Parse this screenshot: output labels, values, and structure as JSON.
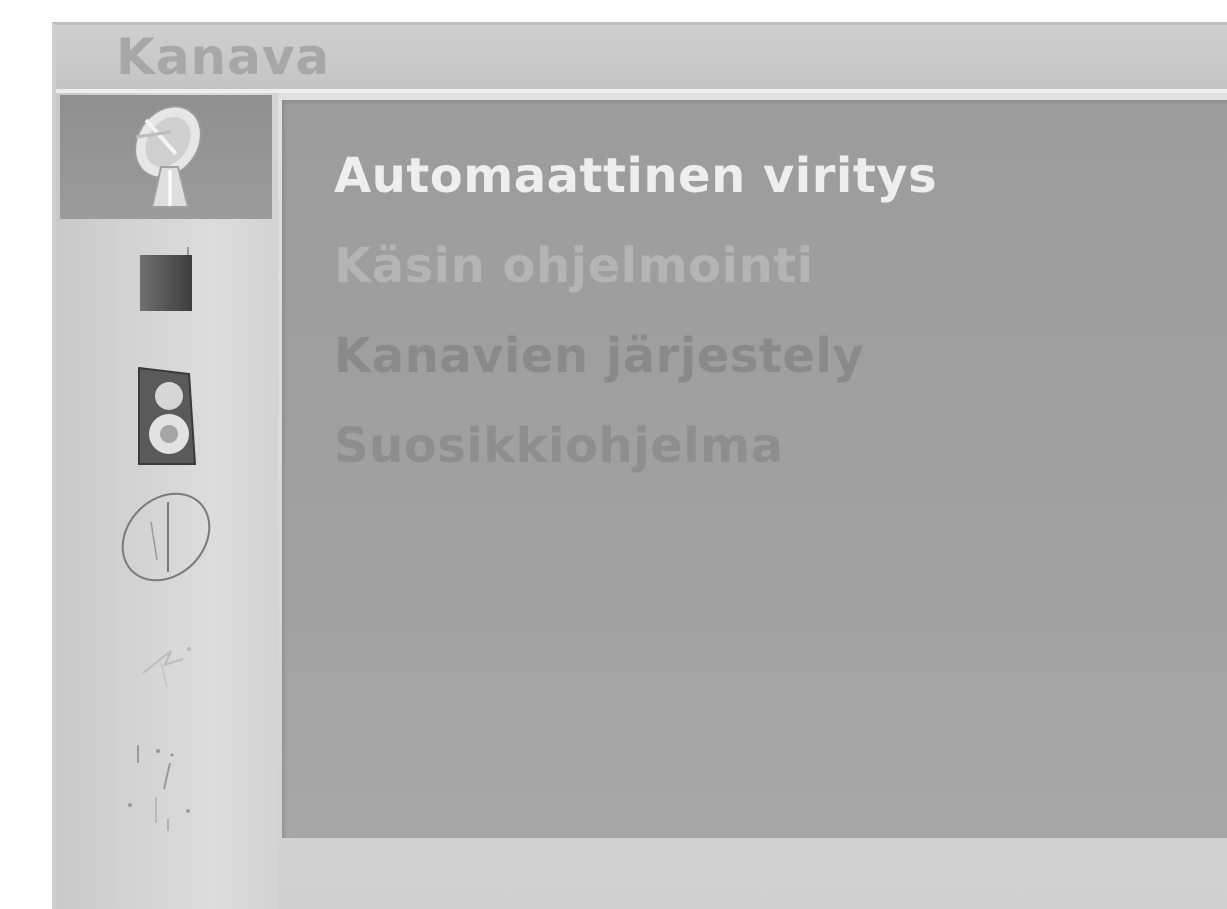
{
  "menu": {
    "title": "Kanava",
    "items": [
      {
        "label": "Automaattinen viritys",
        "selected": true
      },
      {
        "label": "Käsin ohjelmointi",
        "selected": false
      },
      {
        "label": "Kanavien järjestely",
        "selected": false
      },
      {
        "label": "Suosikkiohjelma",
        "selected": false
      }
    ]
  },
  "sidebar": {
    "icons": [
      {
        "name": "satellite-dish-icon",
        "selected": true
      },
      {
        "name": "picture-icon",
        "selected": false
      },
      {
        "name": "sound-icon",
        "selected": false
      },
      {
        "name": "clock-icon",
        "selected": false
      },
      {
        "name": "special-icon",
        "selected": false
      },
      {
        "name": "screen-icon",
        "selected": false
      }
    ]
  },
  "colors": {
    "frame": "#d8d8d8",
    "panel": "#a0a0a0",
    "selected_text": "#eeeeee",
    "selected_icon_bg": "#969696"
  }
}
